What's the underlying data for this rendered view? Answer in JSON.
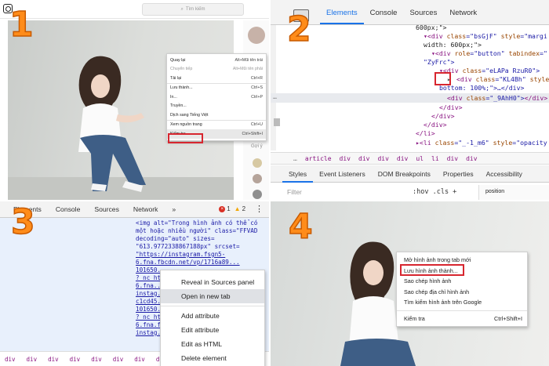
{
  "steps": [
    "1",
    "2",
    "3",
    "4"
  ],
  "q1": {
    "search_placeholder": "Tìm kiếm",
    "side_text": "Gợi ý",
    "menu": [
      {
        "label": "Quay lại",
        "shortcut": "Alt+Mũi tên trái"
      },
      {
        "label": "Chuyển tiếp",
        "shortcut": "Alt+Mũi tên phải"
      },
      {
        "label": "Tải lại",
        "shortcut": "Ctrl+R"
      },
      {
        "label": "Lưu thành...",
        "shortcut": "Ctrl+S"
      },
      {
        "label": "In...",
        "shortcut": "Ctrl+P"
      },
      {
        "label": "Truyền...",
        "shortcut": ""
      },
      {
        "label": "Dịch sang Tiếng Việt",
        "shortcut": ""
      },
      {
        "label": "Xem nguồn trang",
        "shortcut": "Ctrl+U"
      },
      {
        "label": "Kiểm tra",
        "shortcut": "Ctrl+Shift+I"
      }
    ]
  },
  "q2": {
    "tabs": [
      "Elements",
      "Console",
      "Sources",
      "Network"
    ],
    "code": {
      "l1": "600px;\">",
      "l2_tag": "▾<div ",
      "l2_attr": "class",
      "l2_val": "\"bsGjF\"",
      "l2_attr2": " style",
      "l2_val2": "=\"margi",
      "l3": "width: 600px;\">",
      "l4_tag": "▾<div ",
      "l4_attr": "role",
      "l4_val": "=\"button\"",
      "l4_attr2": " tabindex",
      "l4_val2": "=\"",
      "l5": "\"ZyFrc\">",
      "l6_tag": "▾<div ",
      "l6_attr": "class",
      "l6_val": "=\"eLAPa RzuR0\">",
      "l7_tag": "<div ",
      "l7_attr": "class",
      "l7_val": "=\"KL4Bh\"",
      "l7_attr2": " style",
      "l7_val2": "=\"",
      "l8": "bottom: 100%;\">…</div>",
      "l9_tag": "<div ",
      "l9_attr": "class",
      "l9_val": "=\"_9AhH0\">",
      "l9_end": "</div>",
      "l10": "</div>",
      "l11": "</div>",
      "l12": "</div>",
      "l13": "</li>",
      "l14_tag": "▸<li ",
      "l14_attr": "class",
      "l14_val": "=\"_-1_m6\"",
      "l14_attr2": " style",
      "l14_val2": "=\"opacity",
      "ellipsis": "…"
    },
    "breadcrumb": [
      "…",
      "article",
      "div",
      "div",
      "div",
      "div",
      "ul",
      "li",
      "div",
      "div"
    ],
    "subtabs": [
      "Styles",
      "Event Listeners",
      "DOM Breakpoints",
      "Properties",
      "Accessibility"
    ],
    "filter_placeholder": "Filter",
    "filter_tools": ":hov  .cls  +",
    "box_label": "position"
  },
  "q3": {
    "tabs": [
      "Elements",
      "Console",
      "Sources",
      "Network",
      "»"
    ],
    "errors": "1",
    "warnings": "2",
    "code": [
      "<img alt=\"Trong hình ảnh có thể có",
      "một hoặc nhiều người\" class=\"FFVAD",
      "decoding=\"auto\" sizes=",
      "\"613.9772338867188px\" srcset=",
      "\"https://instagram.fsgn5-",
      "6.fna.fbcdn.net/vp/1716a89...",
      "101650...",
      "? nc_ht...",
      "6.fna...",
      "instag...",
      "c1cd45...",
      "101650...",
      "? nc_ht...",
      "6.fna.f...",
      "instag..."
    ],
    "menu": [
      "Reveal in Sources panel",
      "Open in new tab",
      "Add attribute",
      "Edit attribute",
      "Edit as HTML",
      "Delete element"
    ],
    "breadcrumb": [
      "div",
      "div",
      "div",
      "div",
      "div",
      "div",
      "div",
      "div",
      "div"
    ]
  },
  "q4": {
    "menu": [
      {
        "label": "Mở hình ảnh trong tab mới",
        "shortcut": ""
      },
      {
        "label": "Lưu hình ảnh thành...",
        "shortcut": ""
      },
      {
        "label": "Sao chép hình ảnh",
        "shortcut": ""
      },
      {
        "label": "Sao chép địa chỉ hình ảnh",
        "shortcut": ""
      },
      {
        "label": "Tìm kiếm hình ảnh trên Google",
        "shortcut": ""
      },
      {
        "label": "Kiểm tra",
        "shortcut": "Ctrl+Shift+I"
      }
    ]
  },
  "colors": {
    "step_orange": "#ff8c1a",
    "highlight_red": "#d7262f",
    "devtools_blue": "#1a73e8"
  }
}
